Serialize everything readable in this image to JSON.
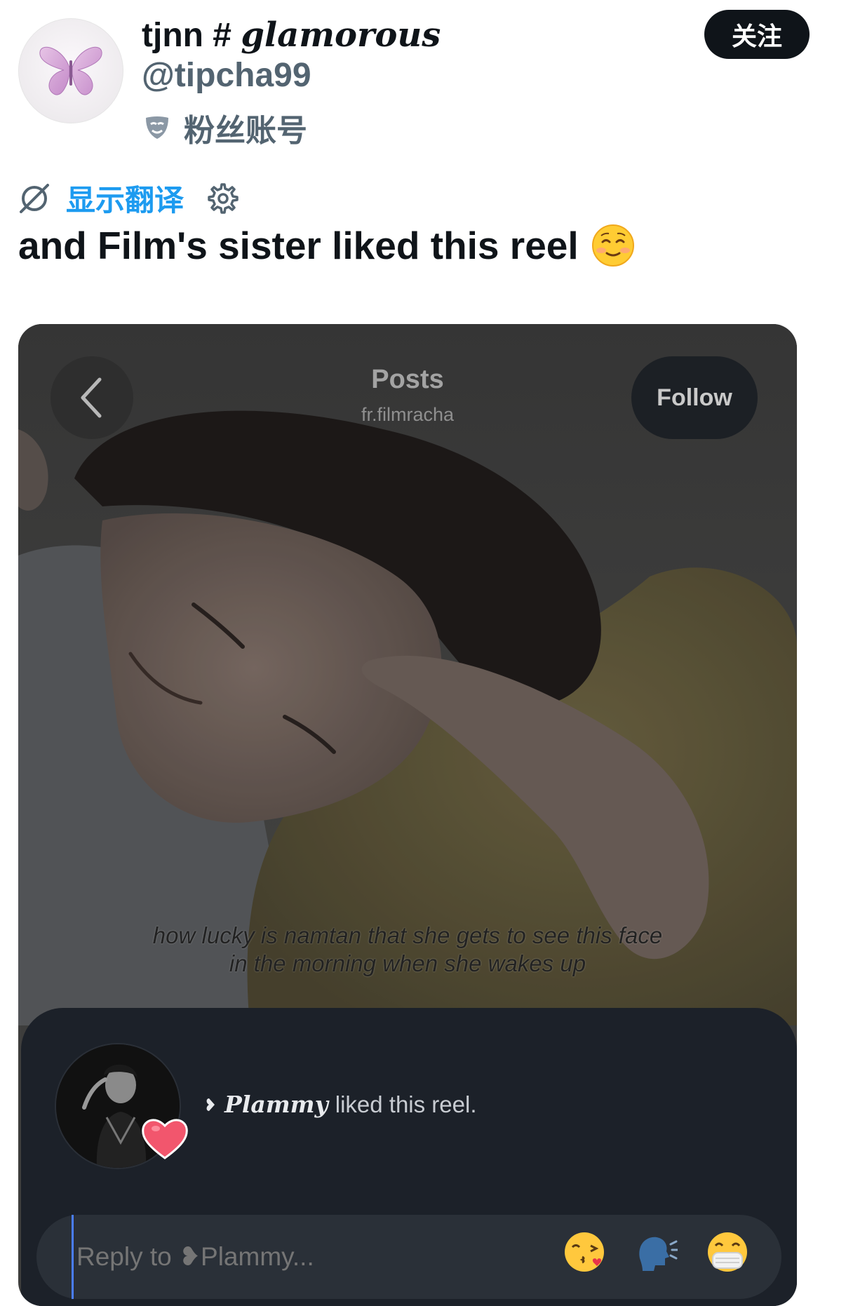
{
  "profile": {
    "display_name_main": "tjnn #",
    "display_name_deco": "glamorous",
    "handle": "@tipcha99",
    "fan_account_label": "粉丝账号",
    "follow_label": "关注"
  },
  "translate": {
    "label": "显示翻译"
  },
  "tweet": {
    "text": "and Film's sister liked this reel"
  },
  "reel": {
    "posts_title": "Posts",
    "posts_account": "fr.filmracha",
    "follow_label": "Follow",
    "caption_line1": "how lucky is namtan that she gets to see this face",
    "caption_line2": "in the morning when she wakes up",
    "liked_user": "Plammy",
    "liked_suffix": "liked this reel.",
    "reply_placeholder": "Reply to ❥Plammy..."
  },
  "icons": {
    "avatar": "butterfly-icon",
    "fan_badge": "mask-icon",
    "translate": "no-translate-icon",
    "settings": "gear-icon",
    "tweet_emoji": "smiling-face-icon",
    "back": "chevron-left-icon",
    "heart": "heart-icon",
    "reply_emojis": [
      "kiss-emoji-icon",
      "speaking-head-icon",
      "mask-face-icon"
    ]
  },
  "colors": {
    "link": "#1d9bf0",
    "follow_bg": "#0f1419",
    "dm_panel": "#1c2129"
  }
}
